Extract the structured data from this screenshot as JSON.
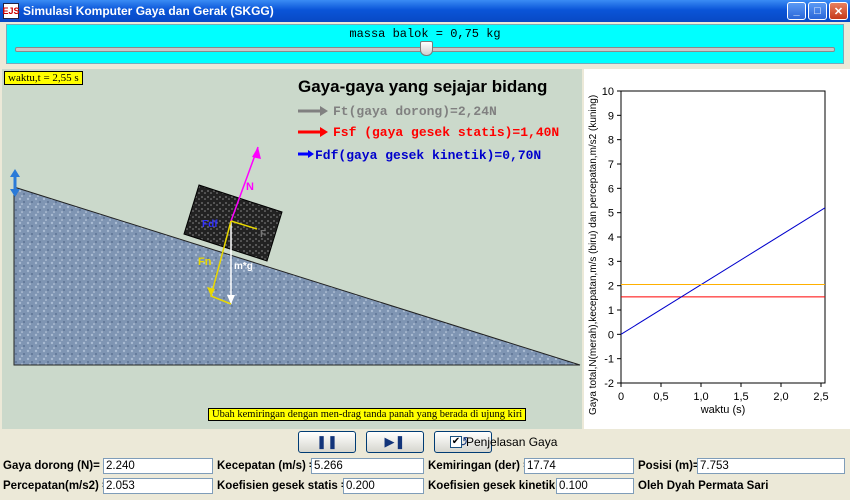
{
  "window": {
    "title": "Simulasi Komputer Gaya dan Gerak (SKGG)",
    "icon_text": "EJS"
  },
  "slider": {
    "label": "massa balok = 0,75 kg",
    "value_fraction": 0.5
  },
  "sim": {
    "time_label": "waktu,t = 2,55 s",
    "forces_title": "Gaya-gaya yang sejajar bidang",
    "force_push": "Ft(gaya dorong)=2,24N",
    "force_static": "Fsf (gaya gesek statis)=1,40N",
    "force_kinetic": "Fdf(gaya gesek kinetik)=0,70N",
    "block_labels": {
      "normal": "N",
      "fn": "Fn",
      "weight": "m*g",
      "fdf": "Fdf",
      "ft": "F"
    },
    "hint": "Ubah kemiringan dengan men-drag tanda panah yang berada di ujung kiri"
  },
  "chart_data": {
    "type": "line",
    "xlabel": "waktu (s)",
    "ylabel": "Gaya total,N(merah),kecepatan,m/s (biru) dan percepatan,m/s2 (kuning)",
    "xlim": [
      0,
      2.55
    ],
    "ylim": [
      -2,
      10
    ],
    "xticks": [
      "0",
      "0,5",
      "1,0",
      "1,5",
      "2,0",
      "2,5"
    ],
    "yticks": [
      "-2",
      "-1",
      "0",
      "1",
      "2",
      "3",
      "4",
      "5",
      "6",
      "7",
      "8",
      "9",
      "10"
    ],
    "series": [
      {
        "color": "#ff0000",
        "x": [
          0,
          2.55
        ],
        "y": [
          1.54,
          1.54
        ]
      },
      {
        "color": "#0000cc",
        "x": [
          0,
          2.55
        ],
        "y": [
          0,
          5.2
        ]
      },
      {
        "color": "#ffb000",
        "x": [
          0,
          2.55
        ],
        "y": [
          2.05,
          2.05
        ]
      }
    ]
  },
  "controls": {
    "pause": "❚❚",
    "step": "▶❚",
    "reset": "↺",
    "checkbox_label": "Penjelasan Gaya",
    "checkbox_checked": true
  },
  "params": {
    "gaya_dorong_label": "Gaya dorong (N)=",
    "gaya_dorong_value": "2.240",
    "kecepatan_label": "Kecepatan (m/s) =",
    "kecepatan_value": "5.266",
    "kemiringan_label": "Kemiringan (der) =",
    "kemiringan_value": "17.74",
    "posisi_label": "Posisi (m)=",
    "posisi_value": "7.753",
    "percepatan_label": "Percepatan(m/s2) =",
    "percepatan_value": "2.053",
    "gesek_statis_label": "Koefisien gesek statis =",
    "gesek_statis_value": "0.200",
    "gesek_kinetik_label": "Koefisien gesek kinetik =",
    "gesek_kinetik_value": "0.100",
    "author": "Oleh Dyah Permata Sari"
  }
}
